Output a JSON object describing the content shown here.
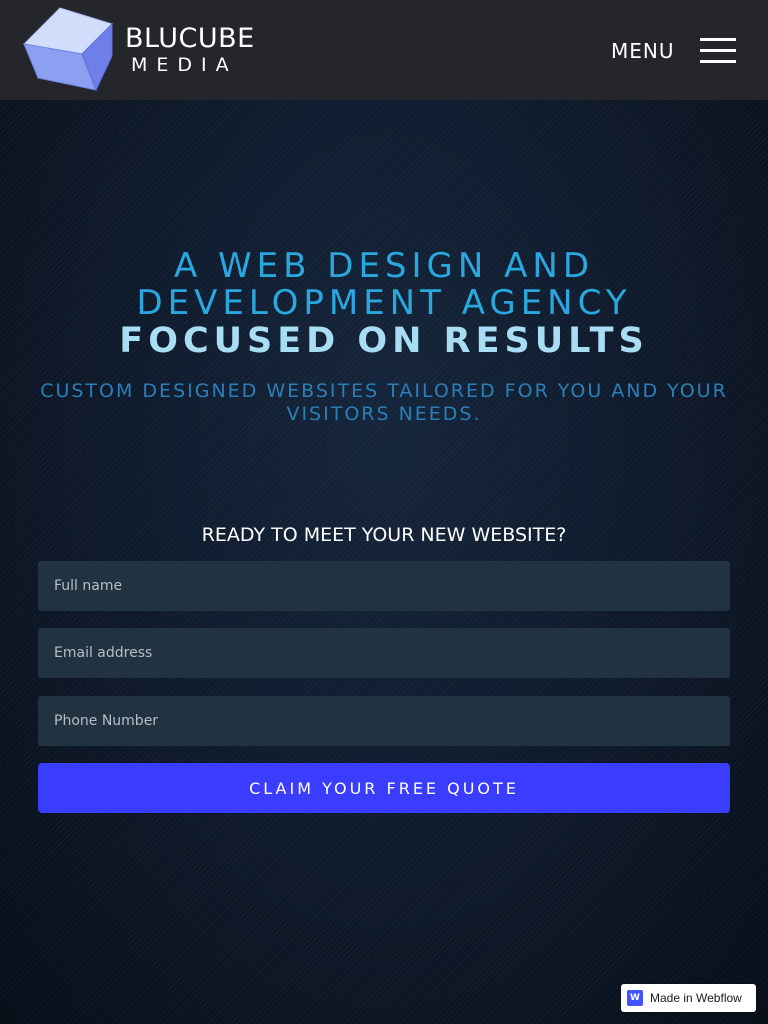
{
  "header": {
    "brand_name": "BLUCUBE",
    "brand_sub": "MEDIA",
    "menu_label": "MENU"
  },
  "hero": {
    "headline_line1": "A WEB DESIGN AND",
    "headline_line2": "DEVELOPMENT AGENCY",
    "headline_strong": "FOCUSED ON RESULTS",
    "subhead": "CUSTOM DESIGNED WEBSITES TAILORED FOR YOU AND YOUR VISITORS NEEDS."
  },
  "form": {
    "title": "READY TO MEET YOUR NEW WEBSITE?",
    "full_name_placeholder": "Full name",
    "email_placeholder": "Email address",
    "phone_placeholder": "Phone Number",
    "submit_label": "CLAIM YOUR FREE QUOTE"
  },
  "badge": {
    "icon_letter": "W",
    "label": "Made in Webflow"
  },
  "colors": {
    "header_bg": "#24262b",
    "accent_blue": "#28a8df",
    "button_blue": "#3a3cff",
    "field_bg": "#213240"
  }
}
